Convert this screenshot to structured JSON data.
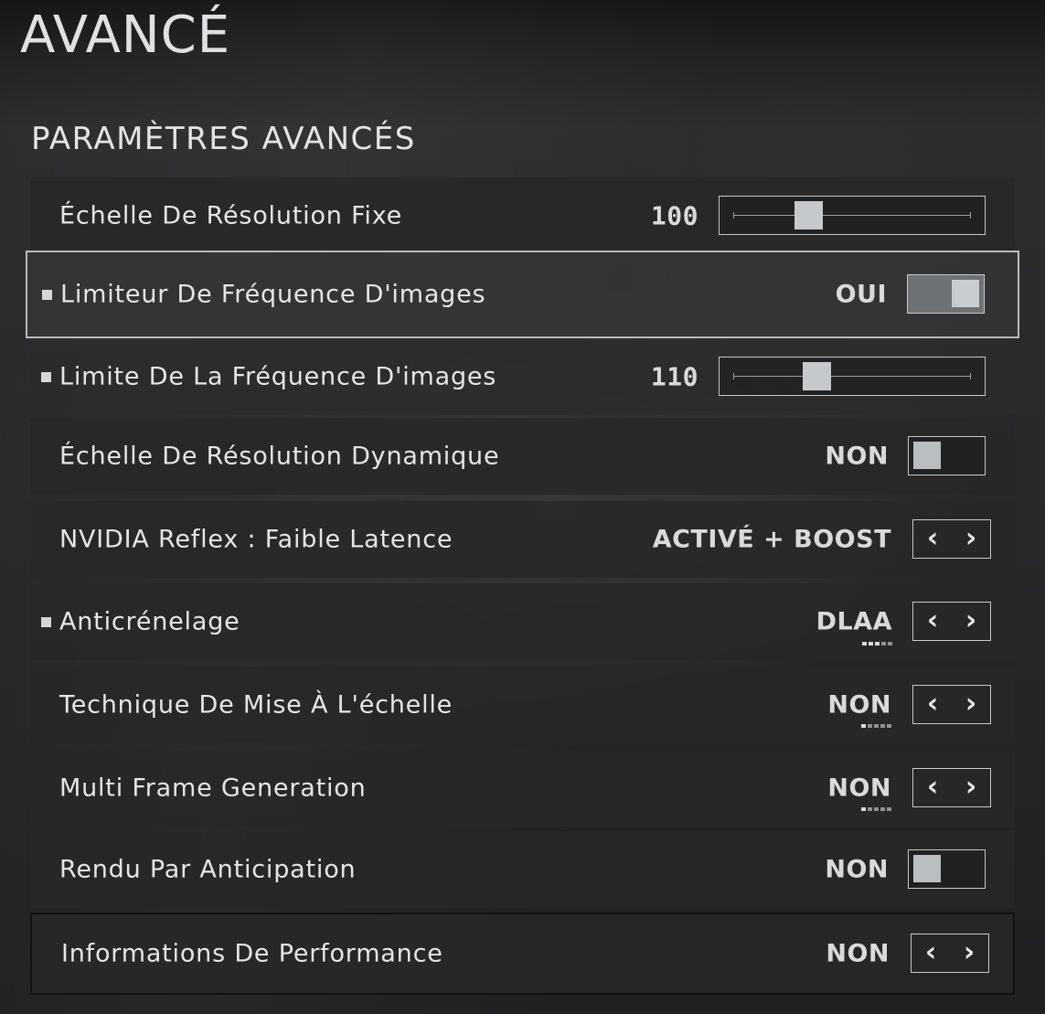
{
  "header": {
    "title": "AVANCÉ"
  },
  "section": {
    "title": "PARAMÈTRES AVANCÉS"
  },
  "rows": [
    {
      "label": "Échelle De Résolution Fixe",
      "control": "slider",
      "value": "100",
      "level_percent": 29
    },
    {
      "label": "Limiteur De Fréquence D'images",
      "control": "toggle",
      "value": "OUI",
      "state": "on",
      "bullet": true,
      "highlighted": true
    },
    {
      "label": "Limite De La Fréquence D'images",
      "control": "slider",
      "value": "110",
      "level_percent": 33,
      "bullet": true
    },
    {
      "label": "Échelle De Résolution Dynamique",
      "control": "toggle",
      "value": "NON",
      "state": "off"
    },
    {
      "label": "NVIDIA Reflex : Faible Latence",
      "control": "selector",
      "value": "ACTIVÉ + BOOST"
    },
    {
      "label": "Anticrénelage",
      "control": "selector",
      "value": "DLAA",
      "bullet": true,
      "option_index": 3,
      "option_count": 5
    },
    {
      "label": "Technique De Mise À L'échelle",
      "control": "selector",
      "value": "NON",
      "option_index": 1,
      "option_count": 5
    },
    {
      "label": "Multi Frame Generation",
      "control": "selector",
      "value": "NON",
      "option_index": 1,
      "option_count": 5
    },
    {
      "label": "Rendu Par Anticipation",
      "control": "toggle",
      "value": "NON",
      "state": "off"
    },
    {
      "label": "Informations De Performance",
      "control": "selector",
      "value": "NON"
    }
  ],
  "icons": {
    "previous": "chevron-left-icon",
    "next": "chevron-right-icon",
    "bullet": "square-bullet-icon"
  },
  "colors": {
    "row_bg": "#262829",
    "control_border": "#c7cacc",
    "text": "#e4e6e8"
  }
}
